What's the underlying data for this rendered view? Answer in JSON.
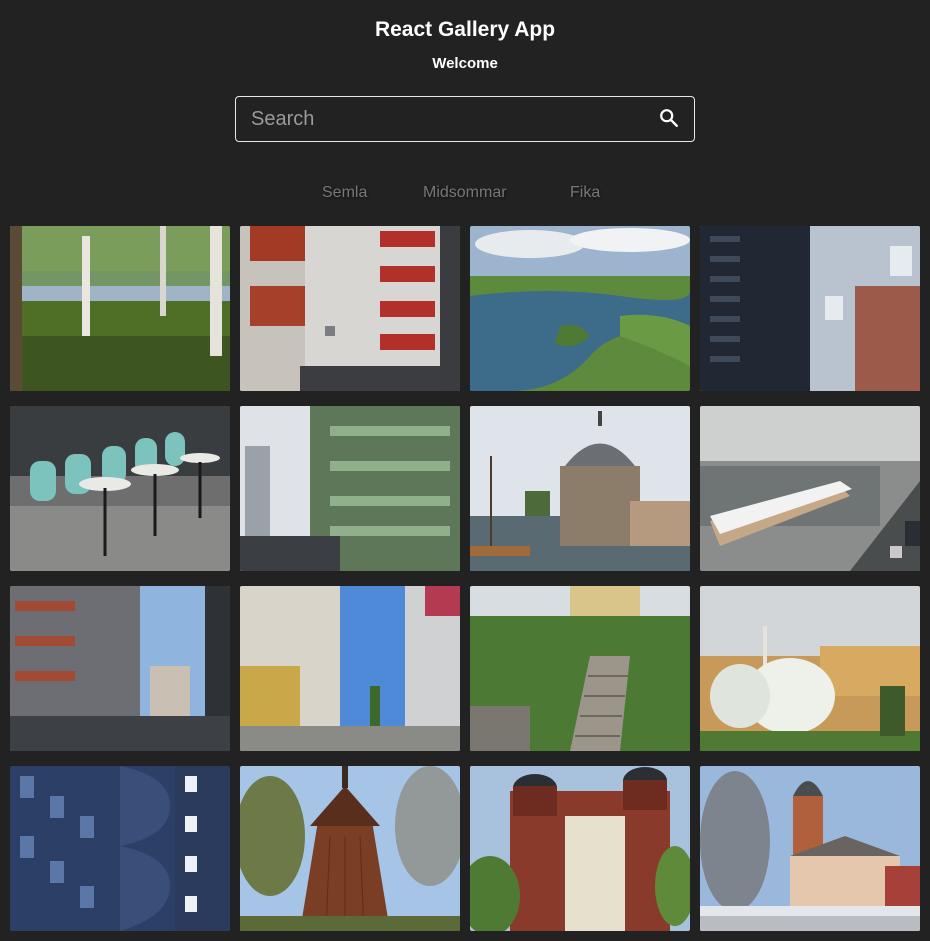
{
  "header": {
    "title": "React Gallery App",
    "subtitle": "Welcome"
  },
  "search": {
    "placeholder": "Search",
    "value": "",
    "button_icon": "search-icon"
  },
  "nav": {
    "links": [
      {
        "label": "Semla"
      },
      {
        "label": "Midsommar"
      },
      {
        "label": "Fika"
      }
    ]
  },
  "gallery": {
    "photos": [
      {
        "subject": "birch trees by lake"
      },
      {
        "subject": "apartment building with red balconies"
      },
      {
        "subject": "aerial view of river and islands"
      },
      {
        "subject": "tall dark residential towers"
      },
      {
        "subject": "turquoise cafe chairs and tables"
      },
      {
        "subject": "green apartment building"
      },
      {
        "subject": "round stone castle tower by water"
      },
      {
        "subject": "snowy houseboat on canal"
      },
      {
        "subject": "modern apartment blocks"
      },
      {
        "subject": "street with apartment buildings"
      },
      {
        "subject": "stone staircase in garden"
      },
      {
        "subject": "blossoming trees and buildings"
      },
      {
        "subject": "blue curved building facade"
      },
      {
        "subject": "wooden bell tower"
      },
      {
        "subject": "brick building with domed towers"
      },
      {
        "subject": "church tower and houses"
      }
    ]
  },
  "colors": {
    "background": "#222222",
    "text": "#ffffff",
    "nav_text": "#777777",
    "search_border": "#e8e8e8"
  }
}
